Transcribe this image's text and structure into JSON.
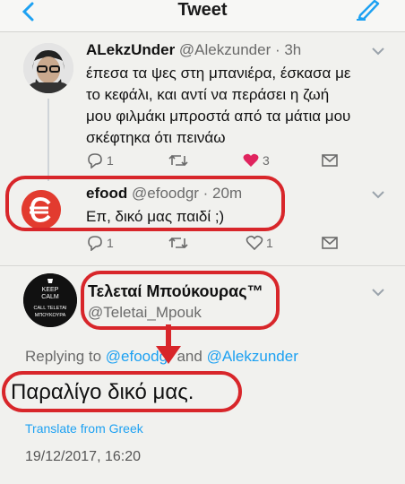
{
  "header": {
    "title": "Tweet"
  },
  "tweets": [
    {
      "name": "ALekzUnder",
      "handle": "@Alekzunder",
      "time": "· 3h",
      "body": [
        "έπεσα τα ψες στη μπανιέρα, έσκασα με",
        "το κεφάλι, και αντί να περάσει η ζωή",
        "μου φιλμάκι μπροστά από τα μάτια μου",
        "σκέφτηκα ότι πεινάω"
      ],
      "replies": "1",
      "likes": "3"
    },
    {
      "name": "efood",
      "handle": "@efoodgr",
      "time": "· 20m",
      "body": [
        "Επ, δικό μας παιδί ;)"
      ],
      "replies": "1",
      "likes": "1"
    }
  ],
  "main_tweet": {
    "name": "Τελεταί Μπούκουρας™",
    "handle": "@Teletai_Mpouk",
    "avatar_text": [
      "KEEP",
      "CALM",
      "CALL TELETAI",
      "ΜΠΟΥΚΟΥΡΑ"
    ],
    "replying_prefix": "Replying to",
    "replying_mention_1": "@efoodgr",
    "replying_and": "and",
    "replying_mention_2": "@Alekzunder",
    "text": "Παραλίγο δικό μας.",
    "translate": "Translate from Greek",
    "timestamp": "19/12/2017, 16:20"
  },
  "colors": {
    "accent": "#1da1f2",
    "like": "#e0245e",
    "annotation": "#d8262a"
  }
}
